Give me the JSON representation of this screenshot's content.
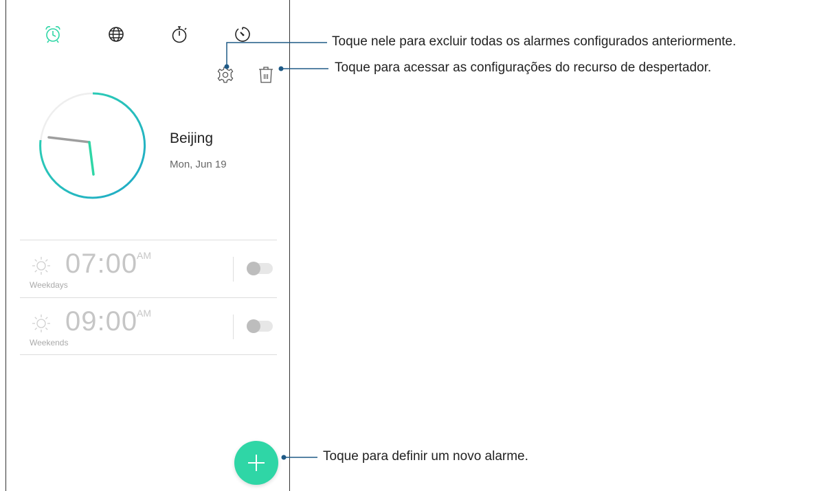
{
  "clock": {
    "city": "Beijing",
    "date": "Mon, Jun 19"
  },
  "tabs": [
    {
      "icon": "alarm-icon"
    },
    {
      "icon": "globe-icon"
    },
    {
      "icon": "stopwatch-icon"
    },
    {
      "icon": "timer-icon"
    }
  ],
  "alarms": [
    {
      "time": "07:00",
      "ampm": "AM",
      "repeat": "Weekdays",
      "enabled": false
    },
    {
      "time": "09:00",
      "ampm": "AM",
      "repeat": "Weekends",
      "enabled": false
    }
  ],
  "callouts": {
    "delete": "Toque nele para excluir todas os alarmes configurados anteriormente.",
    "settings": "Toque para acessar as configurações do recurso de despertador.",
    "add": "Toque para definir um novo alarme."
  },
  "colors": {
    "accent": "#2fd6a6",
    "line": "#1f5a86",
    "clock_blue": "#23b8c9"
  }
}
